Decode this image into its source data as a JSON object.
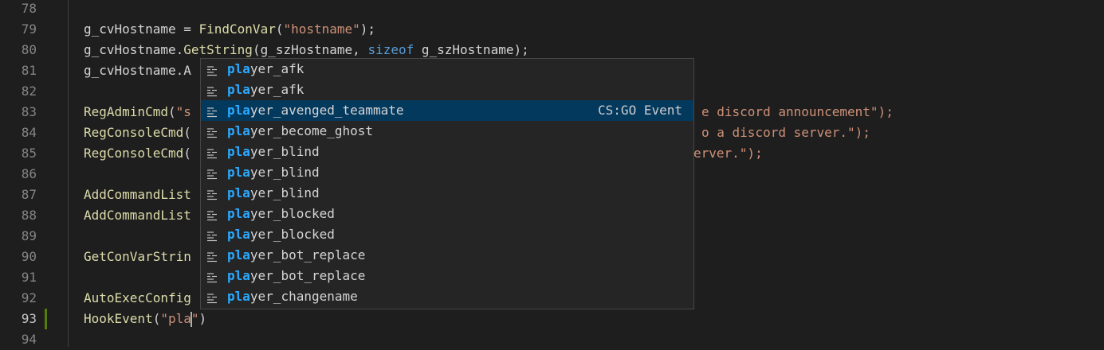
{
  "editor": {
    "lines": [
      {
        "num": "78",
        "tokens": []
      },
      {
        "num": "79",
        "tokens": [
          {
            "t": "g_cvHostname = ",
            "c": "var"
          },
          {
            "t": "FindConVar",
            "c": "fn"
          },
          {
            "t": "(",
            "c": "var"
          },
          {
            "t": "\"hostname\"",
            "c": "str"
          },
          {
            "t": ");",
            "c": "var"
          }
        ]
      },
      {
        "num": "80",
        "tokens": [
          {
            "t": "g_cvHostname.",
            "c": "var"
          },
          {
            "t": "GetString",
            "c": "fn"
          },
          {
            "t": "(g_szHostname, ",
            "c": "var"
          },
          {
            "t": "sizeof",
            "c": "kw"
          },
          {
            "t": " g_szHostname);",
            "c": "var"
          }
        ]
      },
      {
        "num": "81",
        "tokens": [
          {
            "t": "g_cvHostname.A",
            "c": "var"
          }
        ]
      },
      {
        "num": "82",
        "tokens": []
      },
      {
        "num": "83",
        "tokens": [
          {
            "t": "RegAdminCmd",
            "c": "fn"
          },
          {
            "t": "(",
            "c": "var"
          },
          {
            "t": "\"s",
            "c": "str"
          }
        ],
        "tail": "e discord announcement\");"
      },
      {
        "num": "84",
        "tokens": [
          {
            "t": "RegConsoleCmd",
            "c": "fn"
          },
          {
            "t": "(",
            "c": "var"
          }
        ],
        "tail": "o a discord server.\");"
      },
      {
        "num": "85",
        "tokens": [
          {
            "t": "RegConsoleCmd",
            "c": "fn"
          },
          {
            "t": "(",
            "c": "var"
          }
        ],
        "tail": "erver.\");"
      },
      {
        "num": "86",
        "tokens": []
      },
      {
        "num": "87",
        "tokens": [
          {
            "t": "AddCommandList",
            "c": "fn"
          }
        ]
      },
      {
        "num": "88",
        "tokens": [
          {
            "t": "AddCommandList",
            "c": "fn"
          }
        ]
      },
      {
        "num": "89",
        "tokens": []
      },
      {
        "num": "90",
        "tokens": [
          {
            "t": "GetConVarStrin",
            "c": "fn"
          }
        ]
      },
      {
        "num": "91",
        "tokens": []
      },
      {
        "num": "92",
        "tokens": [
          {
            "t": "AutoExecConfig",
            "c": "fn"
          }
        ]
      },
      {
        "num": "93",
        "active": true,
        "tokens": [
          {
            "t": "HookEvent",
            "c": "fn"
          },
          {
            "t": "(",
            "c": "var"
          },
          {
            "t": "\"pla",
            "c": "str"
          },
          {
            "t": "CURSOR",
            "c": "cursor"
          },
          {
            "t": "\"",
            "c": "str"
          },
          {
            "t": ")",
            "c": "var"
          }
        ]
      },
      {
        "num": "94",
        "tokens": []
      }
    ]
  },
  "suggest": {
    "query": "pla",
    "items": [
      {
        "match": "pla",
        "rest": "yer_afk",
        "detail": ""
      },
      {
        "match": "pla",
        "rest": "yer_afk",
        "detail": ""
      },
      {
        "match": "pla",
        "rest": "yer_avenged_teammate",
        "detail": "CS:GO Event",
        "selected": true
      },
      {
        "match": "pla",
        "rest": "yer_become_ghost",
        "detail": ""
      },
      {
        "match": "pla",
        "rest": "yer_blind",
        "detail": ""
      },
      {
        "match": "pla",
        "rest": "yer_blind",
        "detail": ""
      },
      {
        "match": "pla",
        "rest": "yer_blind",
        "detail": ""
      },
      {
        "match": "pla",
        "rest": "yer_blocked",
        "detail": ""
      },
      {
        "match": "pla",
        "rest": "yer_blocked",
        "detail": ""
      },
      {
        "match": "pla",
        "rest": "yer_bot_replace",
        "detail": ""
      },
      {
        "match": "pla",
        "rest": "yer_bot_replace",
        "detail": ""
      },
      {
        "match": "pla",
        "rest": "yer_changename",
        "detail": ""
      }
    ],
    "item_icon": "event-icon",
    "colors": {
      "highlight": "#2aaaff",
      "selected_bg": "#04395e",
      "string": "#ce9178",
      "function": "#dcdcaa",
      "keyword": "#569cd6"
    }
  }
}
